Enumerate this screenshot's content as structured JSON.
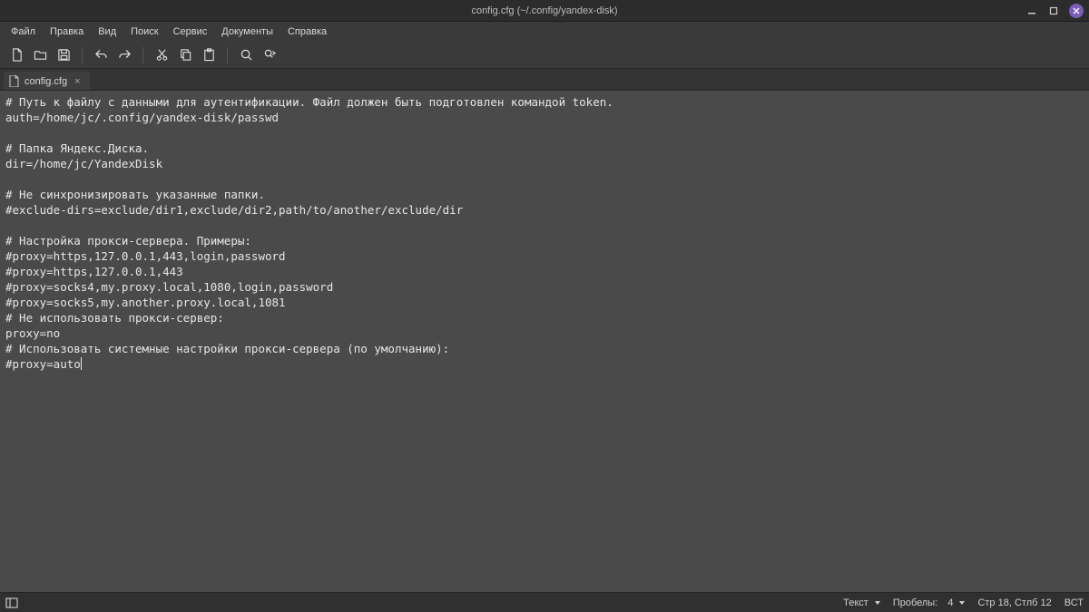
{
  "window": {
    "title": "config.cfg (~/.config/yandex-disk)"
  },
  "menubar": [
    "Файл",
    "Правка",
    "Вид",
    "Поиск",
    "Сервис",
    "Документы",
    "Справка"
  ],
  "tab": {
    "label": "config.cfg"
  },
  "editor_lines": [
    "# Путь к файлу с данными для аутентификации. Файл должен быть подготовлен командой token.",
    "auth=/home/jc/.config/yandex-disk/passwd",
    "",
    "# Папка Яндекс.Диска.",
    "dir=/home/jc/YandexDisk",
    "",
    "# Не синхронизировать указанные папки.",
    "#exclude-dirs=exclude/dir1,exclude/dir2,path/to/another/exclude/dir",
    "",
    "# Настройка прокси-сервера. Примеры:",
    "#proxy=https,127.0.0.1,443,login,password",
    "#proxy=https,127.0.0.1,443",
    "#proxy=socks4,my.proxy.local,1080,login,password",
    "#proxy=socks5,my.another.proxy.local,1081",
    "# Не использовать прокси-сервер:",
    "proxy=no",
    "# Использовать системные настройки прокси-сервера (по умолчанию):",
    "#proxy=auto"
  ],
  "statusbar": {
    "syntax": "Текст",
    "tabwidth_label": "Пробелы:",
    "tabwidth_value": "4",
    "line_col": "Стр 18, Стлб 12",
    "insert_mode": "ВСТ"
  }
}
